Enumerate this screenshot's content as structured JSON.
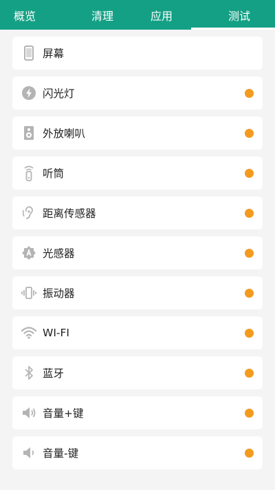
{
  "tabs": [
    {
      "label": "概览"
    },
    {
      "label": "清理"
    },
    {
      "label": "应用"
    },
    {
      "label": "测试"
    }
  ],
  "active_tab": "测试",
  "colors": {
    "header": "#14a085",
    "status_dot": "#f39a1f",
    "icon": "#b4b4b4"
  },
  "tests": [
    {
      "label": "屏幕",
      "icon": "phone-screen-icon",
      "status": "none"
    },
    {
      "label": "闪光灯",
      "icon": "flash-icon",
      "status": "pending"
    },
    {
      "label": "外放喇叭",
      "icon": "speaker-icon",
      "status": "pending"
    },
    {
      "label": "听筒",
      "icon": "earpiece-icon",
      "status": "pending"
    },
    {
      "label": "距离传感器",
      "icon": "ear-sensor-icon",
      "status": "pending"
    },
    {
      "label": "光感器",
      "icon": "auto-brightness-icon",
      "status": "pending"
    },
    {
      "label": "振动器",
      "icon": "vibrate-icon",
      "status": "pending"
    },
    {
      "label": "WI-FI",
      "icon": "wifi-icon",
      "status": "pending"
    },
    {
      "label": "蓝牙",
      "icon": "bluetooth-icon",
      "status": "pending"
    },
    {
      "label": "音量+键",
      "icon": "volume-up-icon",
      "status": "pending"
    },
    {
      "label": "音量-键",
      "icon": "volume-down-icon",
      "status": "pending"
    }
  ]
}
